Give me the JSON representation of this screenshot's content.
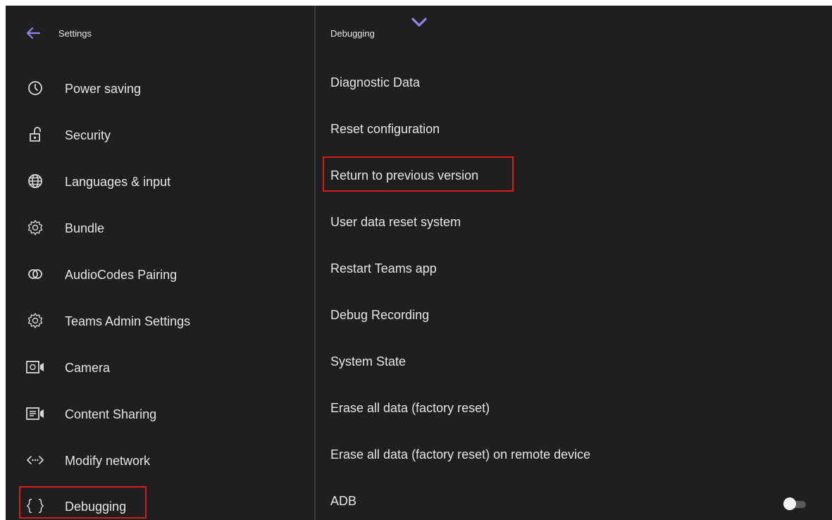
{
  "left": {
    "title": "Settings",
    "items": [
      {
        "label": "Power saving",
        "icon": "clock-icon"
      },
      {
        "label": "Security",
        "icon": "unlock-icon"
      },
      {
        "label": "Languages & input",
        "icon": "globe-icon"
      },
      {
        "label": "Bundle",
        "icon": "gear-icon"
      },
      {
        "label": "AudioCodes Pairing",
        "icon": "pairing-icon"
      },
      {
        "label": "Teams Admin Settings",
        "icon": "gear-icon"
      },
      {
        "label": "Camera",
        "icon": "camera-icon"
      },
      {
        "label": "Content Sharing",
        "icon": "content-sharing-icon"
      },
      {
        "label": "Modify network",
        "icon": "network-icon"
      },
      {
        "label": "Debugging",
        "icon": "braces-icon"
      }
    ]
  },
  "right": {
    "title": "Debugging",
    "items": [
      {
        "label": "Diagnostic Data"
      },
      {
        "label": "Reset configuration"
      },
      {
        "label": "Return to previous version"
      },
      {
        "label": "User data reset system"
      },
      {
        "label": "Restart Teams app"
      },
      {
        "label": "Debug Recording"
      },
      {
        "label": "System State"
      },
      {
        "label": "Erase all data (factory reset)"
      },
      {
        "label": "Erase all data (factory reset) on remote device"
      },
      {
        "label": "ADB"
      }
    ],
    "adb_toggle_on": false
  },
  "colors": {
    "background": "#1f1f1f",
    "accent": "#8f86e8",
    "highlight": "#d91a1a",
    "text": "#e6e6e6"
  }
}
